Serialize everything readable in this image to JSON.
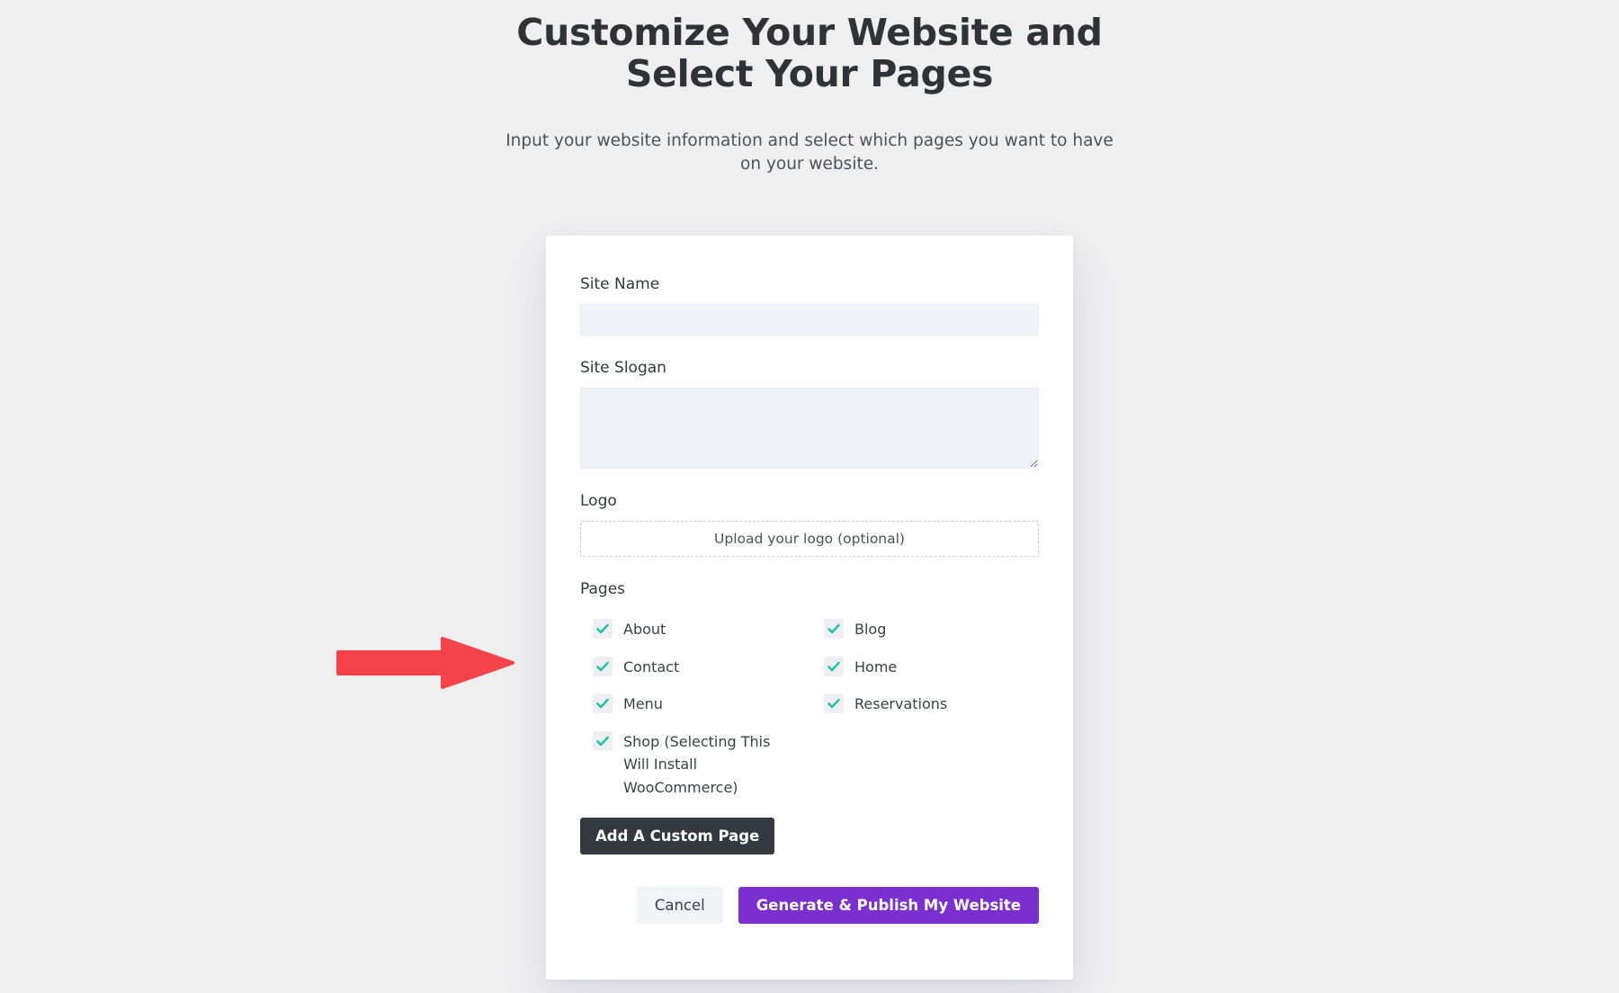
{
  "header": {
    "title": "Customize Your Website and Select Your Pages",
    "subtitle": "Input your website information and select which pages you want to have on your website."
  },
  "form": {
    "site_name": {
      "label": "Site Name",
      "value": "",
      "placeholder": ""
    },
    "site_slogan": {
      "label": "Site Slogan",
      "value": "",
      "placeholder": ""
    },
    "logo": {
      "label": "Logo",
      "upload_label": "Upload your logo (optional)"
    },
    "pages": {
      "label": "Pages",
      "items": [
        {
          "label": "About",
          "checked": true
        },
        {
          "label": "Blog",
          "checked": true
        },
        {
          "label": "Contact",
          "checked": true
        },
        {
          "label": "Home",
          "checked": true
        },
        {
          "label": "Menu",
          "checked": true
        },
        {
          "label": "Reservations",
          "checked": true
        },
        {
          "label": "Shop (Selecting This Will Install WooCommerce)",
          "checked": true
        }
      ]
    },
    "add_custom_page_label": "Add A Custom Page"
  },
  "actions": {
    "cancel_label": "Cancel",
    "publish_label": "Generate & Publish My Website"
  },
  "annotation": {
    "type": "arrow-right",
    "points_to": "Shop (Selecting This Will Install WooCommerce)",
    "color": "#f6434a"
  },
  "colors": {
    "page_background": "#efeff0",
    "card_background": "#ffffff",
    "input_background": "#eff2f6",
    "checkbox_background": "#eeeef4",
    "check_mark": "#17c79a",
    "primary_button": "#7b2fd0",
    "dark_button": "#33393f",
    "cancel_button": "#f2f3f6",
    "title_text": "#2f3338",
    "body_text": "#4b5359",
    "annotation_red": "#f6434a"
  }
}
